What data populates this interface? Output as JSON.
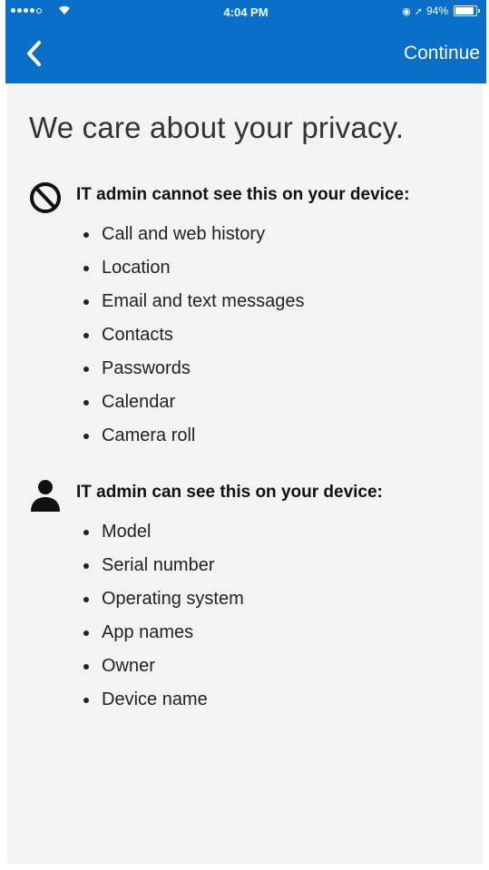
{
  "status_bar": {
    "time": "4:04 PM",
    "battery_percent": "94%",
    "battery_level": 0.94,
    "signal_dots_filled": 4,
    "signal_dots_total": 5
  },
  "nav": {
    "back_icon": "chevron-left-icon",
    "continue_label": "Continue"
  },
  "colors": {
    "header_bg": "#0a6fc9",
    "content_bg": "#f3f3f3"
  },
  "page": {
    "title": "We care about your privacy."
  },
  "cannot_see": {
    "icon": "prohibited-icon",
    "heading": "IT admin cannot see this on your device:",
    "items": [
      "Call and web history",
      "Location",
      "Email and text messages",
      "Contacts",
      "Passwords",
      "Calendar",
      "Camera roll"
    ]
  },
  "can_see": {
    "icon": "person-icon",
    "heading": "IT admin can see this on your device:",
    "items": [
      "Model",
      "Serial number",
      "Operating system",
      "App names",
      "Owner",
      "Device name"
    ]
  }
}
